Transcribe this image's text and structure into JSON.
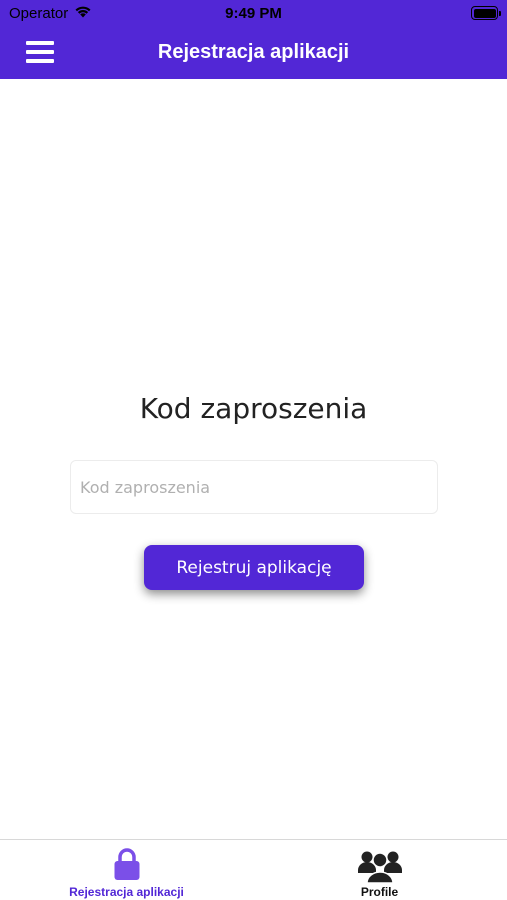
{
  "status_bar": {
    "carrier": "Operator",
    "time": "9:49 PM",
    "wifi_icon": "wifi-icon",
    "battery_icon": "battery-full-icon"
  },
  "nav": {
    "title": "Rejestracja aplikacji",
    "menu_icon": "hamburger-menu-icon"
  },
  "main": {
    "heading": "Kod zaproszenia",
    "invite_input": {
      "value": "",
      "placeholder": "Kod zaproszenia"
    },
    "register_button_label": "Rejestruj aplikację"
  },
  "tabs": [
    {
      "label": "Rejestracja aplikacji",
      "icon": "lock-icon",
      "active": true
    },
    {
      "label": "Profile",
      "icon": "users-icon",
      "active": false
    }
  ],
  "colors": {
    "accent": "#5227d6",
    "background": "#ffffff",
    "active_tab": "#5227d6",
    "inactive_tab": "#111111"
  }
}
